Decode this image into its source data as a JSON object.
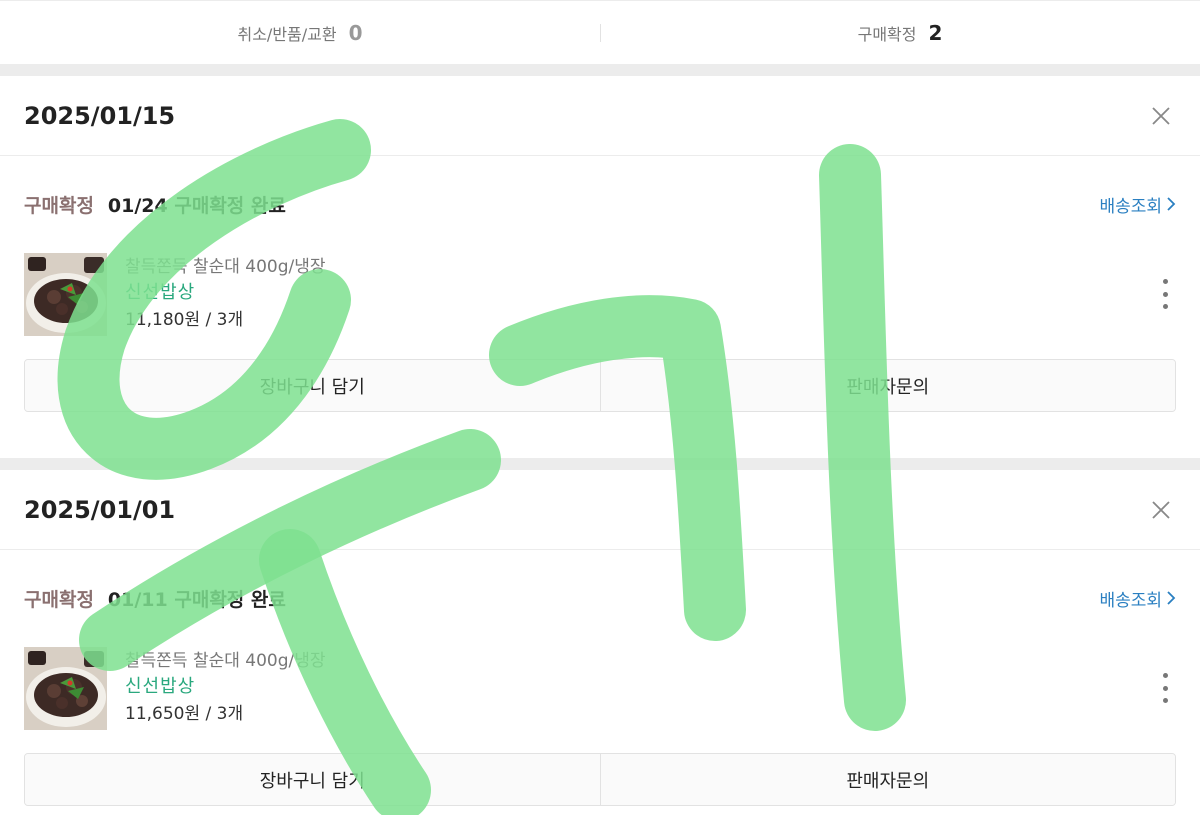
{
  "summary": {
    "items": [
      {
        "label": "취소/반품/교환",
        "count": "0"
      },
      {
        "label": "구매확정",
        "count": "2"
      }
    ]
  },
  "orders": [
    {
      "date": "2025/01/15",
      "status_label": "구매확정",
      "status_detail": "01/24 구매확정 완료",
      "track_label": "배송조회",
      "item": {
        "name": "찰득쫀득 찰순대 400g/냉장",
        "seller": "신선밥상",
        "price": "11,180원 / 3개"
      },
      "buttons": {
        "cart": "장바구니 담기",
        "inquiry": "판매자문의"
      }
    },
    {
      "date": "2025/01/01",
      "status_label": "구매확정",
      "status_detail": "01/11 구매확정 완료",
      "track_label": "배송조회",
      "item": {
        "name": "찰득쫀득 찰순대 400g/냉장",
        "seller": "신선밥상",
        "price": "11,650원 / 3개"
      },
      "buttons": {
        "cart": "장바구니 담기",
        "inquiry": "판매자문의"
      }
    }
  ],
  "colors": {
    "accent_link": "#2a7fc1",
    "seller": "#2aa87e",
    "status_label": "#8a7070",
    "overlay_stroke": "#7ee08f"
  },
  "icons": [
    "close-icon",
    "chevron-right-icon",
    "more-vertical-icon"
  ]
}
